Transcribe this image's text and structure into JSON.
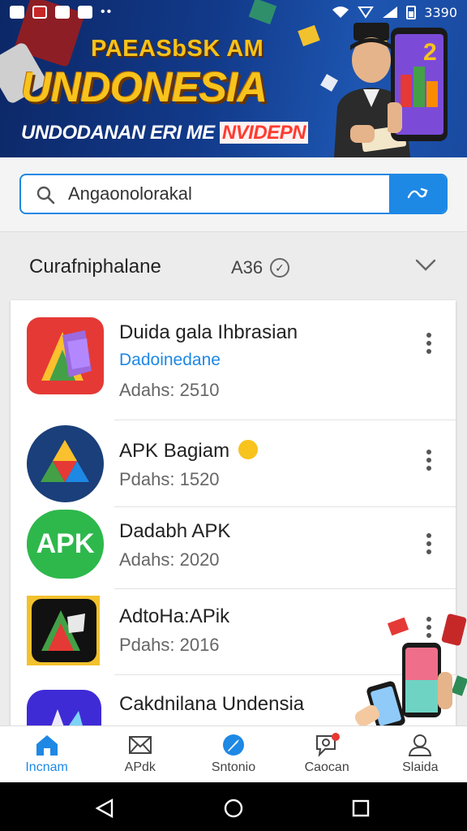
{
  "status_bar": {
    "time": "3390"
  },
  "banner": {
    "title_line1": "PAEASbSK AM",
    "title_line2": "UNDONESIA",
    "subtitle": "UNDODANAN ERI ME",
    "subtitle_highlight": "NVIDEPN"
  },
  "search": {
    "placeholder": "Angaonolorakal",
    "value": "Angaonolorakal"
  },
  "category": {
    "label": "Curafniphalane",
    "code": "A36"
  },
  "apps": [
    {
      "name": "Duida gala Ihbrasian",
      "developer": "Dadoinedane",
      "meta": "Adahs: 2510"
    },
    {
      "name": "APK Bagiam",
      "meta": "Pdahs: 1520"
    },
    {
      "name": "Dadabh APK",
      "meta": "Adahs: 2020",
      "icon_text": "APK"
    },
    {
      "name": "AdtoHa:APik",
      "meta": "Pdahs: 2016"
    },
    {
      "name": "Cakdnilana Undensia"
    }
  ],
  "bottom_nav": [
    {
      "label": "Incnam",
      "icon": "home-icon"
    },
    {
      "label": "APdk",
      "icon": "mail-icon"
    },
    {
      "label": "Sntonio",
      "icon": "compass-icon"
    },
    {
      "label": "Caocan",
      "icon": "chat-icon"
    },
    {
      "label": "Slaida",
      "icon": "profile-icon"
    }
  ],
  "colors": {
    "accent": "#1e88e5",
    "banner": "#123a8a",
    "title_gold": "#f7c31c"
  }
}
